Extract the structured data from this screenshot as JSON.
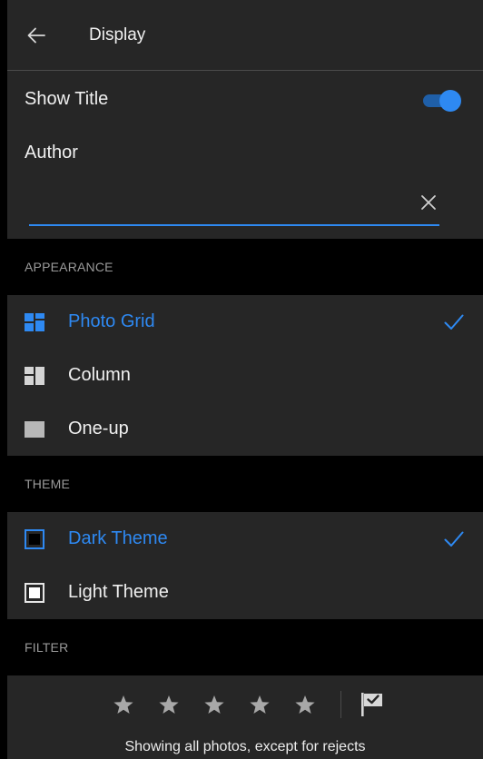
{
  "header": {
    "title": "Display",
    "back_icon": "arrow-left-icon"
  },
  "show_title": {
    "label": "Show Title",
    "enabled": true
  },
  "author": {
    "label": "Author",
    "value": "",
    "placeholder": "",
    "clear_icon": "close-icon"
  },
  "appearance": {
    "section_label": "APPEARANCE",
    "options": [
      {
        "label": "Photo Grid",
        "icon": "photo-grid-icon",
        "selected": true
      },
      {
        "label": "Column",
        "icon": "column-icon",
        "selected": false
      },
      {
        "label": "One-up",
        "icon": "one-up-icon",
        "selected": false
      }
    ]
  },
  "theme": {
    "section_label": "THEME",
    "options": [
      {
        "label": "Dark Theme",
        "icon": "dark-theme-icon",
        "selected": true
      },
      {
        "label": "Light Theme",
        "icon": "light-theme-icon",
        "selected": false
      }
    ]
  },
  "filter": {
    "section_label": "FILTER",
    "star_rating": 0,
    "star_count": 5,
    "flag_icon": "flag-icon",
    "status_text": "Showing all photos, except for rejects"
  },
  "colors": {
    "accent": "#2e89f2",
    "background": "#262626",
    "section_background": "#000000",
    "text": "#f0f0f0",
    "muted_text": "#9a9a9a"
  }
}
